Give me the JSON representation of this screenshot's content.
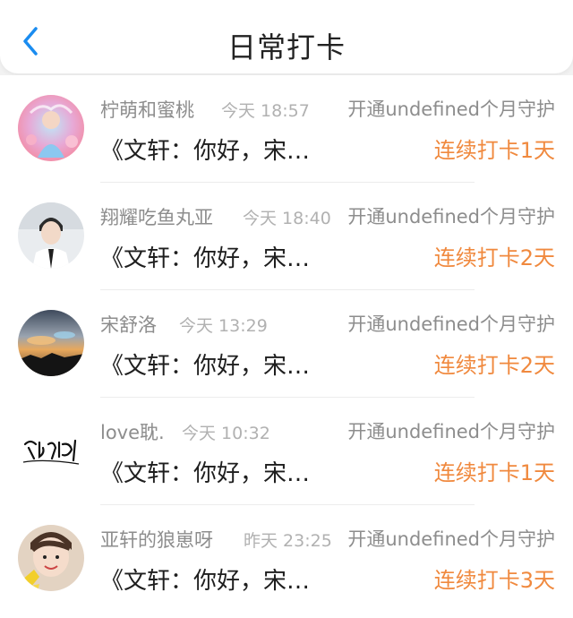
{
  "header": {
    "title": "日常打卡",
    "back_icon": "chevron-left-icon",
    "accent": "#1a8cf0"
  },
  "records": [
    {
      "name": "柠萌和蜜桃",
      "time": "今天 18:57",
      "action": "开通undefined个月守护",
      "message": "《文轩：你好，宋…",
      "streak": "连续打卡1天"
    },
    {
      "name": "翔耀吃鱼丸亚",
      "time": "今天 18:40",
      "action": "开通undefined个月守护",
      "message": "《文轩：你好，宋…",
      "streak": "连续打卡2天"
    },
    {
      "name": "宋舒洛",
      "time": "今天 13:29",
      "action": "开通undefined个月守护",
      "message": "《文轩：你好，宋…",
      "streak": "连续打卡2天"
    },
    {
      "name": "love耽.",
      "time": "今天 10:32",
      "action": "开通undefined个月守护",
      "message": "《文轩：你好，宋…",
      "streak": "连续打卡1天"
    },
    {
      "name": "亚轩的狼崽呀",
      "time": "昨天 23:25",
      "action": "开通undefined个月守护",
      "message": "《文轩：你好，宋…",
      "streak": "连续打卡3天"
    }
  ],
  "colors": {
    "streak": "#f0893e",
    "muted": "#8d8d8d",
    "time": "#b1b1b1",
    "text": "#1e1e1e"
  }
}
